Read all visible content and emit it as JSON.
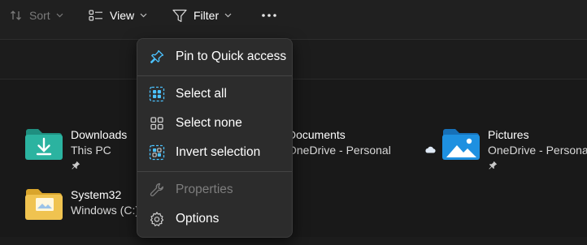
{
  "toolbar": {
    "sort_label": "Sort",
    "view_label": "View",
    "filter_label": "Filter",
    "more_icon": "more-horizontal-icon"
  },
  "context_menu": {
    "items": [
      {
        "label": "Pin to Quick access",
        "icon": "pin-icon",
        "enabled": true
      },
      {
        "label": "Select all",
        "icon": "select-all-icon",
        "enabled": true
      },
      {
        "label": "Select none",
        "icon": "select-none-icon",
        "enabled": true
      },
      {
        "label": "Invert selection",
        "icon": "invert-selection-icon",
        "enabled": true
      },
      {
        "label": "Properties",
        "icon": "wrench-icon",
        "enabled": false
      },
      {
        "label": "Options",
        "icon": "gear-icon",
        "enabled": true
      }
    ]
  },
  "quick_access": [
    {
      "name": "Downloads",
      "location": "This PC",
      "pinned": true,
      "icon": "downloads-folder-icon"
    },
    {
      "name": "Documents",
      "location": "OneDrive - Personal",
      "pinned": true,
      "icon": "documents-folder-icon"
    },
    {
      "name": "Pictures",
      "location": "OneDrive - Personal",
      "pinned": true,
      "icon": "pictures-folder-icon"
    },
    {
      "name": "System32",
      "location": "Windows (C:)\\Windows",
      "pinned": false,
      "icon": "folder-icon"
    }
  ],
  "colors": {
    "accent": "#4cc2ff",
    "background": "#191919",
    "menu_background": "#2c2c2c",
    "downloads_folder": "#2bb3a0",
    "pictures_folder": "#1e90e0",
    "system_folder": "#f0c350"
  }
}
